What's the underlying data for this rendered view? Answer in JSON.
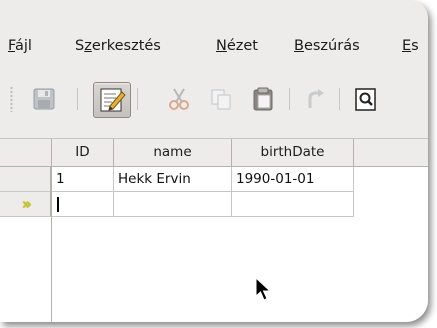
{
  "menubar": {
    "items": [
      {
        "pre": "",
        "mnem": "F",
        "post": "ájl"
      },
      {
        "pre": "S",
        "mnem": "z",
        "post": "erkesztés"
      },
      {
        "pre": "",
        "mnem": "N",
        "post": "ézet"
      },
      {
        "pre": "",
        "mnem": "B",
        "post": "eszúrás"
      },
      {
        "pre": "",
        "mnem": "E",
        "post": "s"
      }
    ]
  },
  "toolbar": {
    "buttons": [
      {
        "icon": "save-icon",
        "enabled": false
      },
      {
        "icon": "edit-data-icon",
        "enabled": true,
        "active": true
      },
      {
        "icon": "cut-icon",
        "enabled": false
      },
      {
        "icon": "copy-icon",
        "enabled": false
      },
      {
        "icon": "paste-icon",
        "enabled": false
      },
      {
        "icon": "undo-icon",
        "enabled": false
      },
      {
        "icon": "find-record-icon",
        "enabled": true
      }
    ]
  },
  "table": {
    "columns": [
      "ID",
      "name",
      "birthDate"
    ],
    "rows": [
      {
        "ID": "1",
        "name": "Hekk Ervin",
        "birthDate": "1990-01-01"
      }
    ],
    "new_row_marker": "»"
  },
  "colors": {
    "window_bg": "#edeceb",
    "grid_bg": "#ffffff",
    "new_row_marker": "#c8c800"
  }
}
